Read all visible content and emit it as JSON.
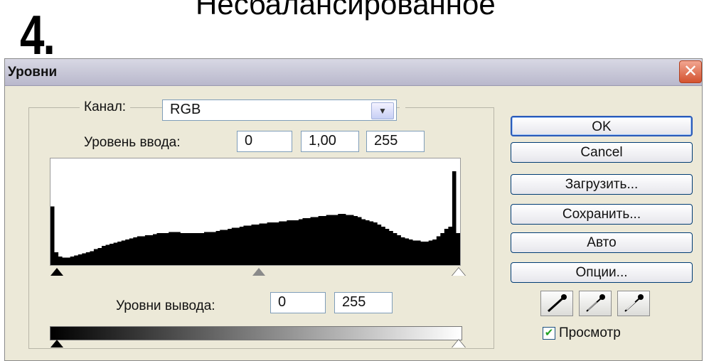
{
  "slide": {
    "number": "4.",
    "title": "Несбалансированное"
  },
  "window": {
    "title": "Уровни",
    "close_glyph": "✕"
  },
  "channel": {
    "label": "Канал:",
    "value": "RGB"
  },
  "input_levels": {
    "label": "Уровень ввода:",
    "black": "0",
    "gamma": "1,00",
    "white": "255"
  },
  "output_levels": {
    "label": "Уровни вывода:",
    "black": "0",
    "white": "255"
  },
  "buttons": {
    "ok": "OK",
    "cancel": "Cancel",
    "load": "Загрузить...",
    "save": "Сохранить...",
    "auto": "Авто",
    "options": "Опции..."
  },
  "preview": {
    "label": "Просмотр",
    "checked": true
  },
  "icons": {
    "close": "close-icon",
    "dropdown": "chevron-down-icon",
    "eyedroppers": [
      "black-eyedropper-icon",
      "gray-eyedropper-icon",
      "white-eyedropper-icon"
    ]
  },
  "histogram": {
    "values": [
      0.55,
      0.12,
      0.08,
      0.07,
      0.07,
      0.08,
      0.09,
      0.1,
      0.11,
      0.12,
      0.13,
      0.15,
      0.16,
      0.18,
      0.19,
      0.2,
      0.21,
      0.22,
      0.23,
      0.24,
      0.25,
      0.26,
      0.27,
      0.27,
      0.28,
      0.28,
      0.29,
      0.3,
      0.3,
      0.3,
      0.31,
      0.31,
      0.31,
      0.3,
      0.3,
      0.3,
      0.3,
      0.3,
      0.3,
      0.31,
      0.31,
      0.31,
      0.32,
      0.33,
      0.33,
      0.34,
      0.35,
      0.35,
      0.36,
      0.37,
      0.37,
      0.38,
      0.38,
      0.39,
      0.39,
      0.4,
      0.4,
      0.4,
      0.41,
      0.41,
      0.42,
      0.42,
      0.42,
      0.43,
      0.44,
      0.44,
      0.45,
      0.45,
      0.46,
      0.46,
      0.47,
      0.47,
      0.47,
      0.48,
      0.48,
      0.47,
      0.47,
      0.46,
      0.45,
      0.43,
      0.42,
      0.41,
      0.4,
      0.38,
      0.36,
      0.34,
      0.32,
      0.3,
      0.28,
      0.26,
      0.25,
      0.24,
      0.23,
      0.23,
      0.22,
      0.22,
      0.23,
      0.24,
      0.27,
      0.3,
      0.34,
      0.36,
      0.88,
      0.3
    ]
  },
  "colors": {
    "accent": "#2a5ab8",
    "dialog_bg": "#ece9d8",
    "close_red": "#d4522f"
  }
}
